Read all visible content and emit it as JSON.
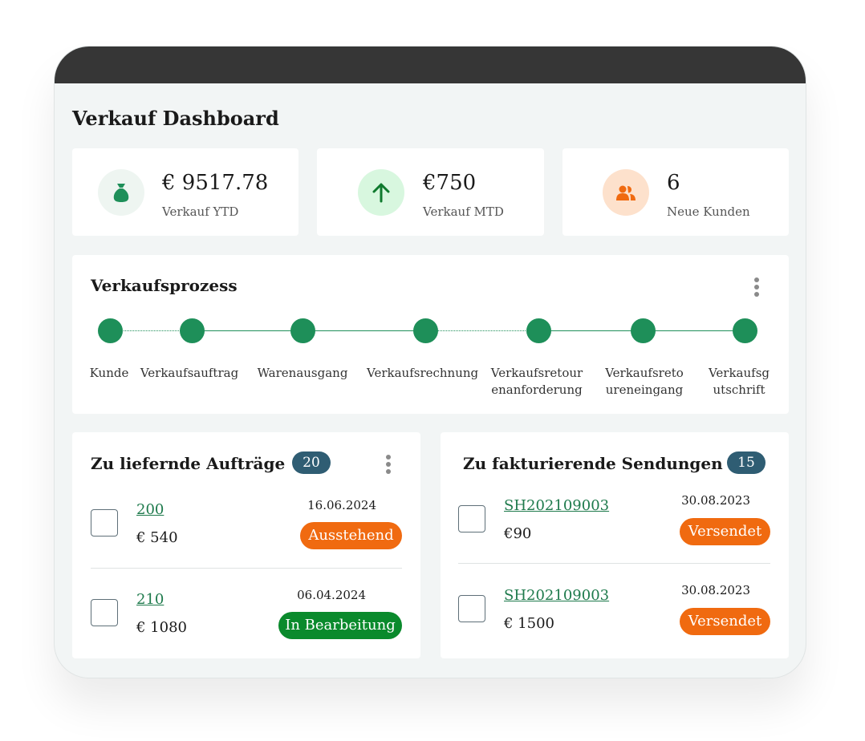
{
  "page_title": "Verkauf Dashboard",
  "kpis": [
    {
      "value": "€ 9517.78",
      "label": "Verkauf YTD",
      "icon": "money-bag-icon",
      "icon_bg": "#eef5f1",
      "icon_color": "#1e8f59"
    },
    {
      "value": "€750",
      "label": "Verkauf MTD",
      "icon": "arrow-up-icon",
      "icon_bg": "#d8f7df",
      "icon_color": "#0f7a2e"
    },
    {
      "value": "6",
      "label": "Neue Kunden",
      "icon": "users-icon",
      "icon_bg": "#fde1cc",
      "icon_color": "#f06a10"
    }
  ],
  "process": {
    "title": "Verkaufsprozess",
    "steps": [
      {
        "line1": "Kunde",
        "line2": ""
      },
      {
        "line1": "Verkaufsauftrag",
        "line2": ""
      },
      {
        "line1": "Warenausgang",
        "line2": ""
      },
      {
        "line1": "Verkaufsrechnung",
        "line2": ""
      },
      {
        "line1": "Verkaufsretour",
        "line2": "enanforderung"
      },
      {
        "line1": "Verkaufsreto",
        "line2": "ureneingang"
      },
      {
        "line1": "Verkaufsg",
        "line2": "utschrift"
      }
    ],
    "accent": "#1e8f59"
  },
  "orders": {
    "title": "Zu liefernde Aufträge",
    "count": "20",
    "rows": [
      {
        "id": "200",
        "amount": "€ 540",
        "date": "16.06.2024",
        "status": "Ausstehend",
        "status_color": "#f06a10"
      },
      {
        "id": "210",
        "amount": "€ 1080",
        "date": "06.04.2024",
        "status": "In Bearbeitung",
        "status_color": "#0a8a2c"
      }
    ]
  },
  "shipments": {
    "title": "Zu fakturierende Sendungen",
    "count": "15",
    "rows": [
      {
        "id": "SH202109003",
        "amount": "€90",
        "date": "30.08.2023",
        "status": "Versendet",
        "status_color": "#f06a10"
      },
      {
        "id": "SH202109003",
        "amount": "€ 1500",
        "date": "30.08.2023",
        "status": "Versendet",
        "status_color": "#f06a10"
      }
    ]
  }
}
